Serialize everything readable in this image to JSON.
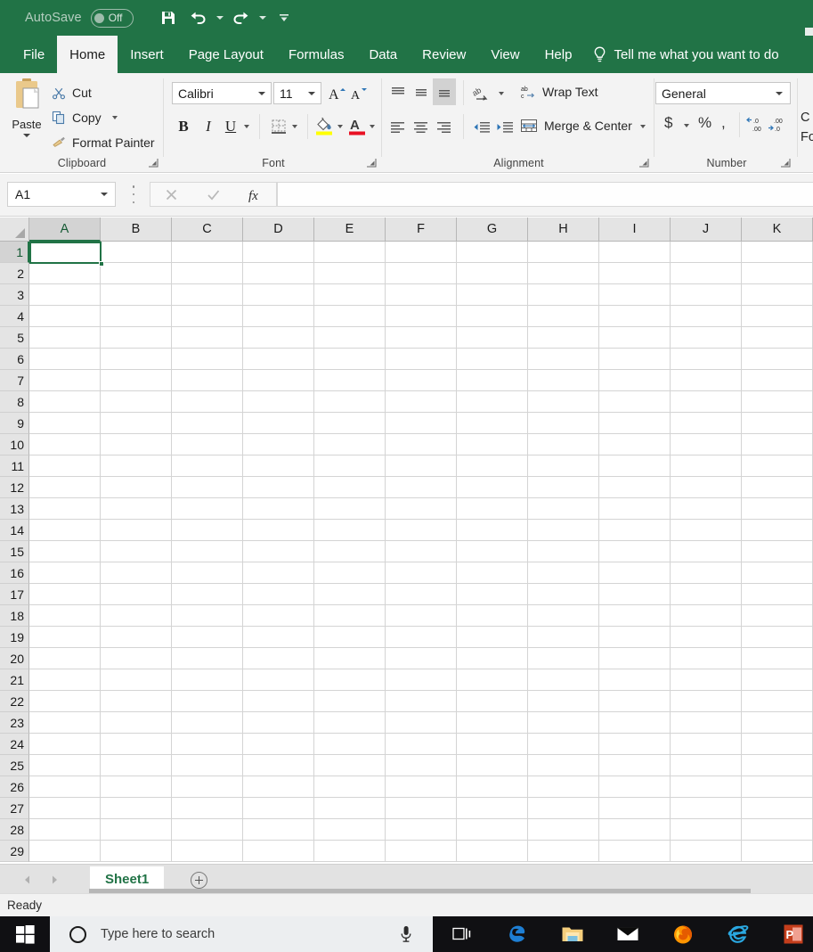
{
  "titlebar": {
    "autosave_label": "AutoSave",
    "autosave_state": "Off",
    "save_icon": "save-icon",
    "undo_icon": "undo-icon",
    "redo_icon": "redo-icon",
    "customize_qat_icon": "customize-quick-access-toolbar-icon"
  },
  "ribbon_tabs": [
    {
      "label": "File",
      "active": false
    },
    {
      "label": "Home",
      "active": true
    },
    {
      "label": "Insert",
      "active": false
    },
    {
      "label": "Page Layout",
      "active": false
    },
    {
      "label": "Formulas",
      "active": false
    },
    {
      "label": "Data",
      "active": false
    },
    {
      "label": "Review",
      "active": false
    },
    {
      "label": "View",
      "active": false
    },
    {
      "label": "Help",
      "active": false
    }
  ],
  "tell_me": {
    "label": "Tell me what you want to do",
    "icon": "lightbulb-icon"
  },
  "ribbon": {
    "clipboard": {
      "title": "Clipboard",
      "paste_label": "Paste",
      "cut_label": "Cut",
      "copy_label": "Copy",
      "format_painter_label": "Format Painter"
    },
    "font": {
      "title": "Font",
      "font_family": "Calibri",
      "font_size": "11",
      "grow_font_label": "A",
      "shrink_font_label": "A",
      "bold_label": "B",
      "italic_label": "I",
      "underline_label": "U"
    },
    "alignment": {
      "title": "Alignment",
      "wrap_text_label": "Wrap Text",
      "merge_center_label": "Merge & Center"
    },
    "number": {
      "title": "Number",
      "format_value": "General",
      "currency_symbol": "$",
      "percent_symbol": "%",
      "comma_symbol": ","
    },
    "styles_cut": {
      "line1": "C",
      "line2": "Fo"
    }
  },
  "formula_bar": {
    "name_box_value": "A1",
    "cancel_icon": "cancel-x-icon",
    "enter_icon": "enter-check-icon",
    "function_icon": "insert-function-fx-icon",
    "formula_value": ""
  },
  "grid": {
    "columns": [
      "A",
      "B",
      "C",
      "D",
      "E",
      "F",
      "G",
      "H",
      "I",
      "J",
      "K"
    ],
    "rows": [
      1,
      2,
      3,
      4,
      5,
      6,
      7,
      8,
      9,
      10,
      11,
      12,
      13,
      14,
      15,
      16,
      17,
      18,
      19,
      20,
      21,
      22,
      23,
      24,
      25,
      26,
      27,
      28,
      29
    ],
    "active_cell": "A1",
    "active_cell_value": ""
  },
  "sheet_bar": {
    "prev_icon": "previous-sheet-arrow-icon",
    "next_icon": "next-sheet-arrow-icon",
    "tabs": [
      {
        "label": "Sheet1",
        "active": true
      }
    ],
    "add_sheet_icon": "add-sheet-plus-icon"
  },
  "status_bar": {
    "status": "Ready"
  },
  "taskbar": {
    "start_icon": "windows-start-icon",
    "search_placeholder": "Type here to search",
    "cortana_icon": "cortana-circle-icon",
    "mic_icon": "microphone-icon",
    "icons": [
      {
        "name": "task-view-icon"
      },
      {
        "name": "microsoft-edge-icon"
      },
      {
        "name": "file-explorer-icon"
      },
      {
        "name": "mail-icon"
      },
      {
        "name": "firefox-icon"
      },
      {
        "name": "internet-explorer-icon"
      },
      {
        "name": "powerpoint-icon"
      }
    ]
  },
  "colors": {
    "excel_green": "#217346",
    "ribbon_bg": "#f3f3f3",
    "header_bg": "#e4e4e4",
    "gridline": "#d4d4d4",
    "taskbar_bg": "#101013"
  }
}
